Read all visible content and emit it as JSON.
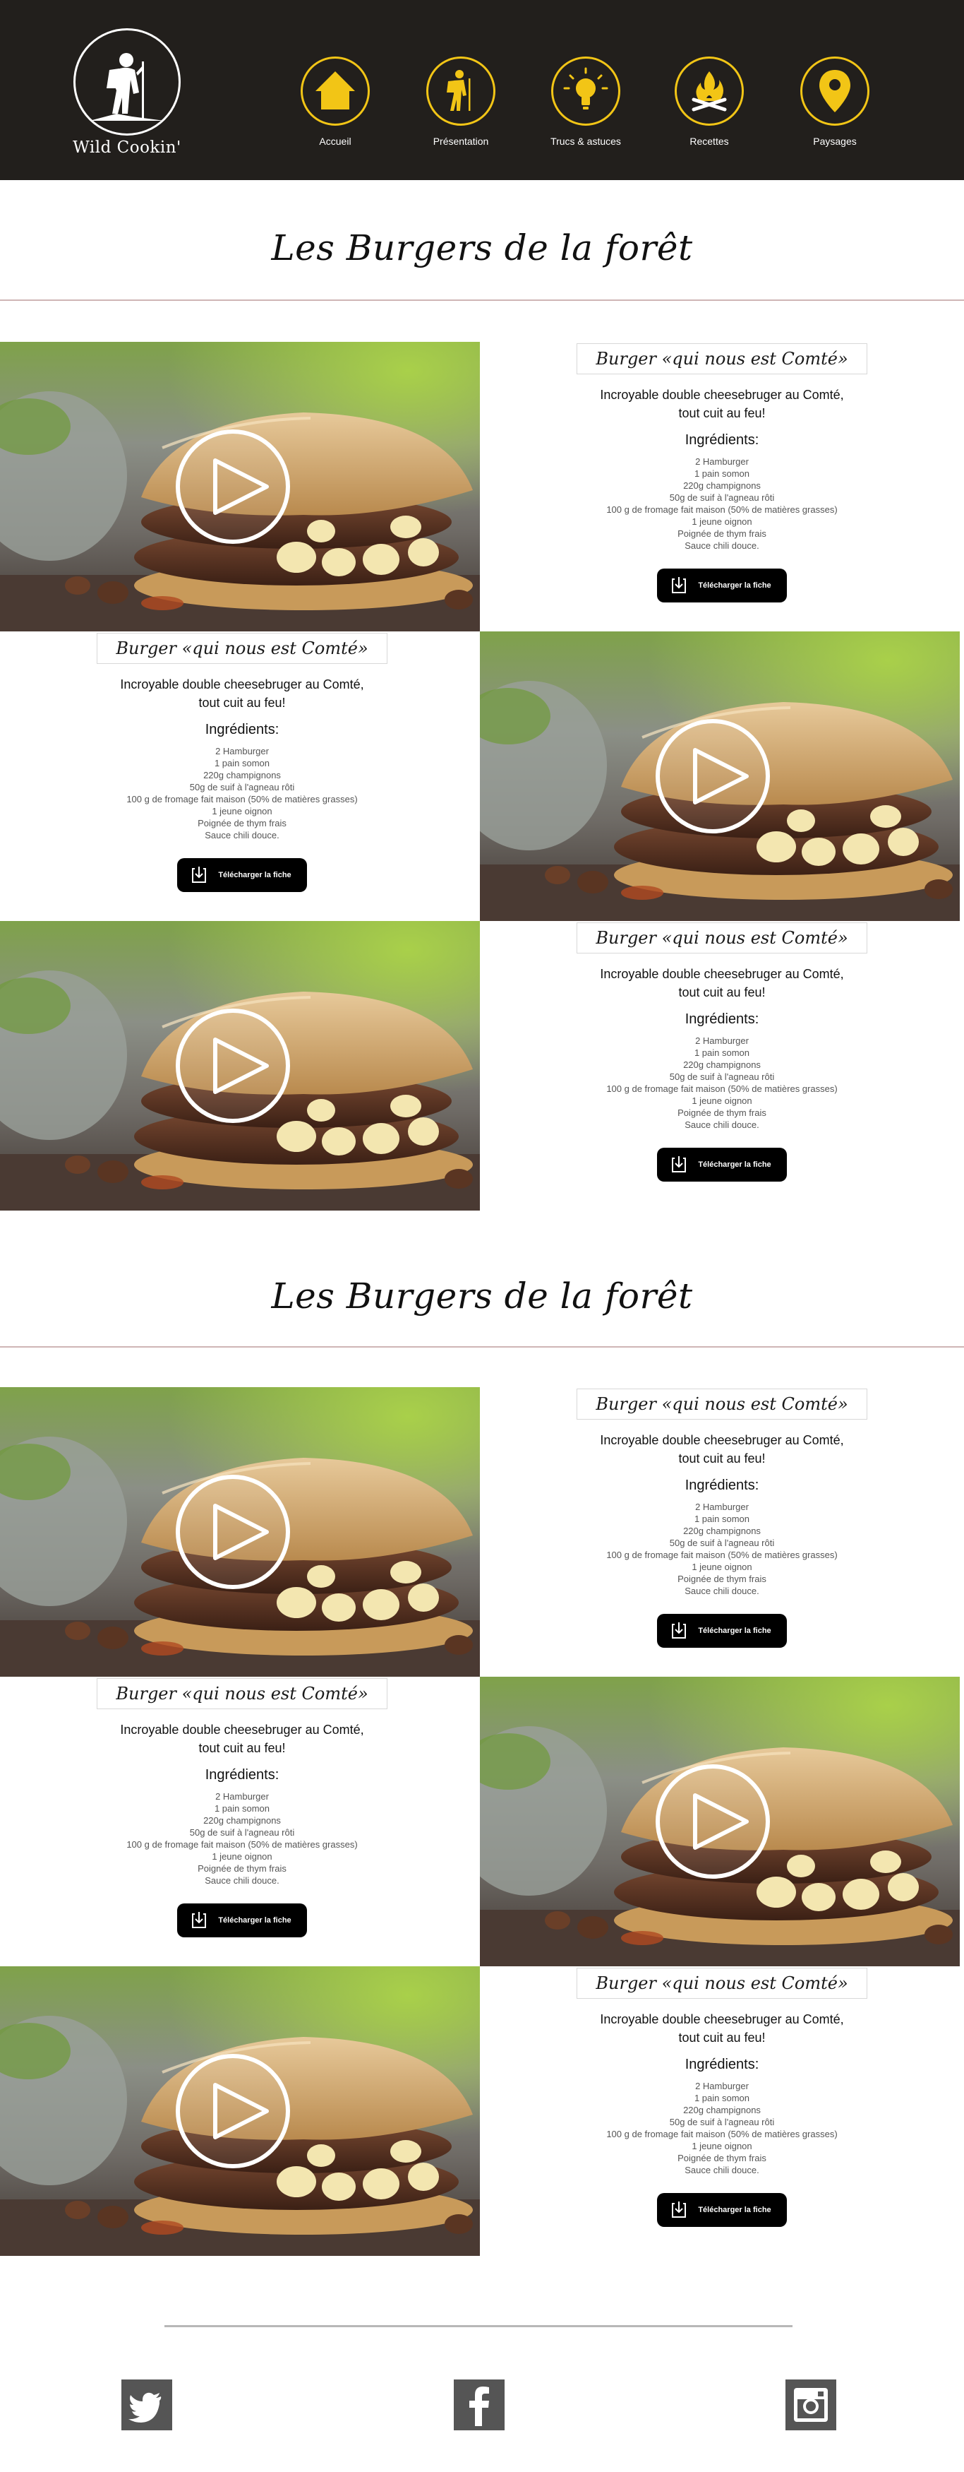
{
  "site": {
    "logo_text": "Wild Cookin'"
  },
  "nav": [
    {
      "label": "Accueil",
      "icon": "home-icon"
    },
    {
      "label": "Présentation",
      "icon": "hiker-icon"
    },
    {
      "label": "Trucs & astuces",
      "icon": "lightbulb-icon"
    },
    {
      "label": "Recettes",
      "icon": "campfire-icon"
    },
    {
      "label": "Paysages",
      "icon": "map-pin-icon"
    }
  ],
  "colors": {
    "header_bg": "#221f1c",
    "accent_yellow": "#f2c516",
    "button_bg": "#000000",
    "social_bg": "#555555"
  },
  "sections": [
    {
      "title": "Les Burgers de la forêt",
      "recipes": [
        {
          "title": "Burger «qui nous est Comté»",
          "subtitle_line1": "Incroyable double cheesebruger  au Comté,",
          "subtitle_line2": "tout cuit au feu!",
          "ingredients_heading": "Ingrédients:",
          "ingredients": [
            "2 Hamburger",
            "1 pain somon",
            "220g champignons",
            "50g de suif à l'agneau rôti",
            "100 g de fromage fait maison (50% de matières grasses)",
            "1 jeune oignon",
            "Poignée de thym frais",
            "Sauce chili douce."
          ],
          "download_label": "Télécharger la fiche"
        },
        {
          "title": "Burger «qui nous est Comté»",
          "subtitle_line1": "Incroyable double cheesebruger  au Comté,",
          "subtitle_line2": "tout cuit au feu!",
          "ingredients_heading": "Ingrédients:",
          "ingredients": [
            "2 Hamburger",
            "1 pain somon",
            "220g champignons",
            "50g de suif à l'agneau rôti",
            "100 g de fromage fait maison (50% de matières grasses)",
            "1 jeune oignon",
            "Poignée de thym frais",
            "Sauce chili douce."
          ],
          "download_label": "Télécharger la fiche"
        },
        {
          "title": "Burger «qui nous est Comté»",
          "subtitle_line1": "Incroyable double cheesebruger  au Comté,",
          "subtitle_line2": "tout cuit au feu!",
          "ingredients_heading": "Ingrédients:",
          "ingredients": [
            "2 Hamburger",
            "1 pain somon",
            "220g champignons",
            "50g de suif à l'agneau rôti",
            "100 g de fromage fait maison (50% de matières grasses)",
            "1 jeune oignon",
            "Poignée de thym frais",
            "Sauce chili douce."
          ],
          "download_label": "Télécharger la fiche"
        }
      ]
    },
    {
      "title": "Les Burgers de la forêt",
      "recipes": [
        {
          "title": "Burger «qui nous est Comté»",
          "subtitle_line1": "Incroyable double cheesebruger  au Comté,",
          "subtitle_line2": "tout cuit au feu!",
          "ingredients_heading": "Ingrédients:",
          "ingredients": [
            "2 Hamburger",
            "1 pain somon",
            "220g champignons",
            "50g de suif à l'agneau rôti",
            "100 g de fromage fait maison (50% de matières grasses)",
            "1 jeune oignon",
            "Poignée de thym frais",
            "Sauce chili douce."
          ],
          "download_label": "Télécharger la fiche"
        },
        {
          "title": "Burger «qui nous est Comté»",
          "subtitle_line1": "Incroyable double cheesebruger  au Comté,",
          "subtitle_line2": "tout cuit au feu!",
          "ingredients_heading": "Ingrédients:",
          "ingredients": [
            "2 Hamburger",
            "1 pain somon",
            "220g champignons",
            "50g de suif à l'agneau rôti",
            "100 g de fromage fait maison (50% de matières grasses)",
            "1 jeune oignon",
            "Poignée de thym frais",
            "Sauce chili douce."
          ],
          "download_label": "Télécharger la fiche"
        },
        {
          "title": "Burger «qui nous est Comté»",
          "subtitle_line1": "Incroyable double cheesebruger  au Comté,",
          "subtitle_line2": "tout cuit au feu!",
          "ingredients_heading": "Ingrédients:",
          "ingredients": [
            "2 Hamburger",
            "1 pain somon",
            "220g champignons",
            "50g de suif à l'agneau rôti",
            "100 g de fromage fait maison (50% de matières grasses)",
            "1 jeune oignon",
            "Poignée de thym frais",
            "Sauce chili douce."
          ],
          "download_label": "Télécharger la fiche"
        }
      ]
    }
  ],
  "footer": {
    "social": [
      "twitter-icon",
      "facebook-icon",
      "instagram-icon"
    ]
  }
}
